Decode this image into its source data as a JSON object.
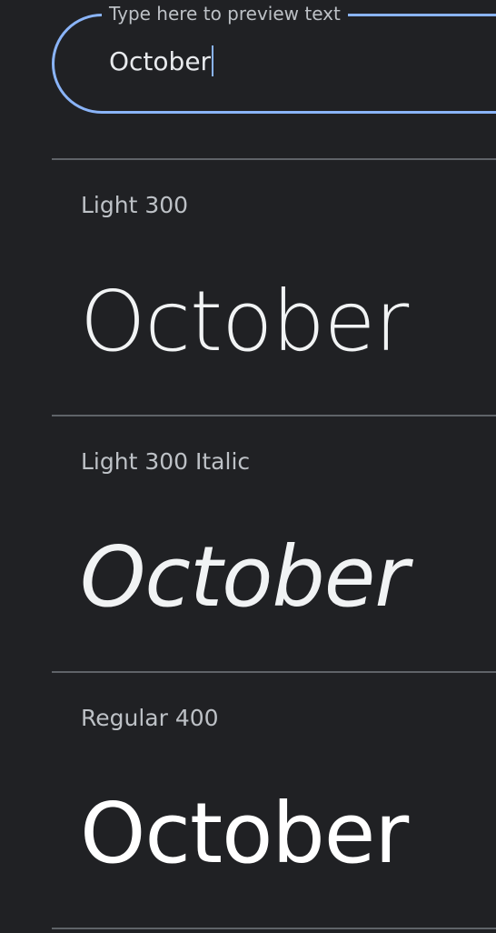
{
  "preview": {
    "label": "Type here to preview text",
    "value": "October"
  },
  "styles": [
    {
      "label": "Light 300",
      "sample": "October"
    },
    {
      "label": "Light 300 Italic",
      "sample": "October"
    },
    {
      "label": "Regular 400",
      "sample": "October"
    }
  ],
  "colors": {
    "background": "#202124",
    "accent": "#8ab4f8",
    "divider": "#5f6368",
    "label": "#bdc1c6",
    "sample": "#ffffff"
  }
}
